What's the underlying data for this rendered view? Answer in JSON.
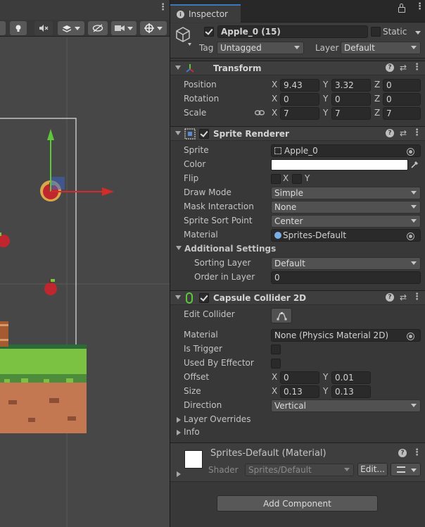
{
  "inspector": {
    "tab_label": "Inspector",
    "object": {
      "name": "Apple_0 (15)",
      "active": true,
      "static_label": "Static",
      "tag_label": "Tag",
      "tag_value": "Untagged",
      "layer_label": "Layer",
      "layer_value": "Default"
    },
    "transform": {
      "title": "Transform",
      "position_label": "Position",
      "rotation_label": "Rotation",
      "scale_label": "Scale",
      "axis_x": "X",
      "axis_y": "Y",
      "axis_z": "Z",
      "position": {
        "x": "9.43",
        "y": "3.32",
        "z": "0"
      },
      "rotation": {
        "x": "0",
        "y": "0",
        "z": "0"
      },
      "scale": {
        "x": "7",
        "y": "7",
        "z": "7"
      }
    },
    "sprite_renderer": {
      "title": "Sprite Renderer",
      "sprite_label": "Sprite",
      "sprite_value": "Apple_0",
      "color_label": "Color",
      "color_value": "#ffffff",
      "flip_label": "Flip",
      "flip_x": "X",
      "flip_y": "Y",
      "draw_mode_label": "Draw Mode",
      "draw_mode_value": "Simple",
      "mask_label": "Mask Interaction",
      "mask_value": "None",
      "sort_point_label": "Sprite Sort Point",
      "sort_point_value": "Center",
      "material_label": "Material",
      "material_value": "Sprites-Default",
      "additional_label": "Additional Settings",
      "sorting_layer_label": "Sorting Layer",
      "sorting_layer_value": "Default",
      "order_label": "Order in Layer",
      "order_value": "0"
    },
    "capsule_collider": {
      "title": "Capsule Collider 2D",
      "edit_collider_label": "Edit Collider",
      "material_label": "Material",
      "material_value": "None (Physics Material 2D)",
      "is_trigger_label": "Is Trigger",
      "used_by_effector_label": "Used By Effector",
      "offset_label": "Offset",
      "offset": {
        "x": "0",
        "y": "0.01"
      },
      "size_label": "Size",
      "size": {
        "x": "0.13",
        "y": "0.13"
      },
      "direction_label": "Direction",
      "direction_value": "Vertical",
      "layer_overrides_label": "Layer Overrides",
      "info_label": "Info"
    },
    "material_preview": {
      "title": "Sprites-Default (Material)",
      "shader_label": "Shader",
      "shader_value": "Sprites/Default",
      "edit_label": "Edit..."
    },
    "add_component_label": "Add Component"
  },
  "colors": {
    "accent": "#3a79bb",
    "panel": "#383838",
    "field": "#2a2a2a",
    "grass": "#7bc142",
    "dirt": "#b86b4b"
  }
}
